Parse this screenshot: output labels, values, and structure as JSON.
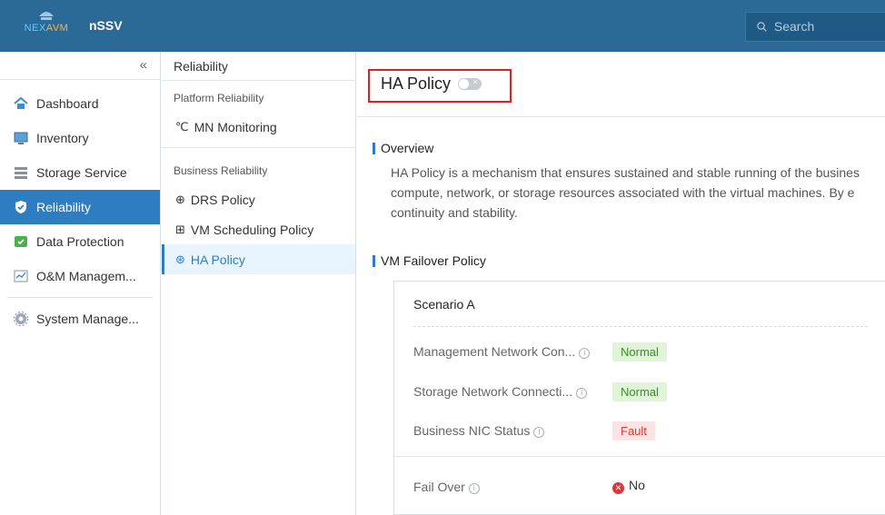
{
  "app": {
    "logo_text_a": "NEX",
    "logo_text_b": "AVM",
    "product": "nSSV",
    "search_placeholder": "Search"
  },
  "sidebar": {
    "collapse_icon": "«",
    "items": [
      {
        "label": "Dashboard",
        "icon": "home-icon"
      },
      {
        "label": "Inventory",
        "icon": "monitor-icon"
      },
      {
        "label": "Storage Service",
        "icon": "storage-icon"
      },
      {
        "label": "Reliability",
        "icon": "shield-icon",
        "active": true
      },
      {
        "label": "Data Protection",
        "icon": "protection-icon"
      },
      {
        "label": "O&M Managem...",
        "icon": "chart-icon"
      },
      {
        "label": "System Manage...",
        "icon": "gear-icon"
      }
    ]
  },
  "subnav": {
    "header": "Reliability",
    "groups": [
      {
        "label": "Platform Reliability",
        "items": [
          {
            "label": "MN Monitoring",
            "glyph": "℃"
          }
        ]
      },
      {
        "label": "Business Reliability",
        "items": [
          {
            "label": "DRS Policy",
            "glyph": "⊕"
          },
          {
            "label": "VM Scheduling Policy",
            "glyph": "⊞"
          },
          {
            "label": "HA Policy",
            "glyph": "⊛",
            "active": true
          }
        ]
      }
    ]
  },
  "main": {
    "title": "HA Policy",
    "toggle_on": false,
    "overview_heading": "Overview",
    "overview_lines": [
      "HA Policy is a mechanism that ensures sustained and stable running of the busines",
      "compute, network, or storage resources associated with the virtual machines. By e",
      "continuity and stability."
    ],
    "failover_heading": "VM Failover Policy",
    "scenario": {
      "title": "Scenario A",
      "rows": [
        {
          "label": "Management Network Con...",
          "status": "Normal"
        },
        {
          "label": "Storage Network Connecti...",
          "status": "Normal"
        },
        {
          "label": "Business NIC Status",
          "status": "Fault"
        }
      ],
      "fail_over_label": "Fail Over",
      "fail_over_value": "No"
    }
  },
  "colors": {
    "topbar": "#2b6a96",
    "accent": "#2d7dc0",
    "normal": "#3a8a26",
    "fault": "#d83b3b",
    "highlight_box": "#e02020"
  }
}
